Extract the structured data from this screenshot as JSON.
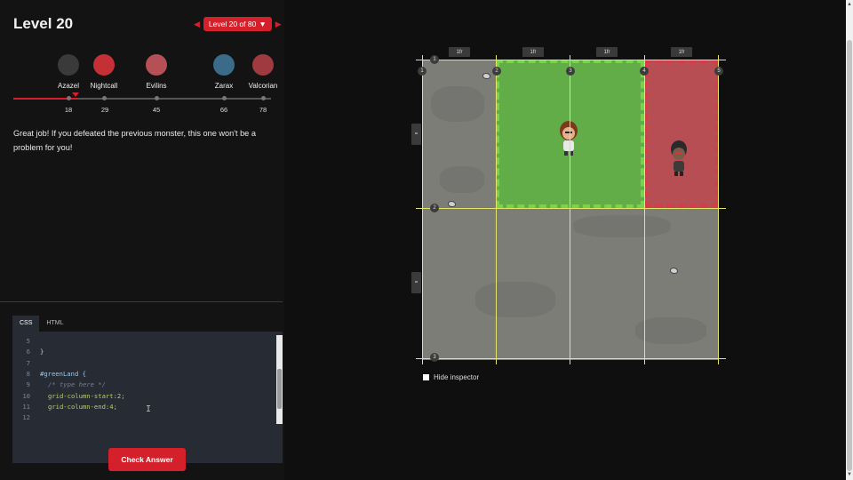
{
  "header": {
    "title": "Level 20",
    "level_selector": "Level 20 of 80"
  },
  "monsters": [
    {
      "name": "Azazel",
      "level": "18",
      "color": "#3a3a3a"
    },
    {
      "name": "Nightcall",
      "level": "29",
      "color": "#c43036"
    },
    {
      "name": "Evilins",
      "level": "45",
      "color": "#b45056"
    },
    {
      "name": "Zarax",
      "level": "66",
      "color": "#3a6c8a"
    },
    {
      "name": "Valcorian",
      "level": "78",
      "color": "#9e3a40"
    }
  ],
  "instructions": "Great job! If you defeated the previous monster, this one won't be a problem for you!",
  "editor": {
    "tabs": [
      "CSS",
      "HTML"
    ],
    "lines": [
      {
        "num": "5",
        "text": ""
      },
      {
        "num": "6",
        "text": "}"
      },
      {
        "num": "7",
        "text": ""
      },
      {
        "num": "8",
        "text": "#greenLand {"
      },
      {
        "num": "9",
        "text": "/* type here */"
      },
      {
        "num": "10",
        "text": "grid-column-start:2;"
      },
      {
        "num": "11",
        "text": "grid-column-end:4;"
      },
      {
        "num": "12",
        "text": ""
      }
    ],
    "check_button": "Check Answer"
  },
  "grid": {
    "column_labels": [
      "1fr",
      "1fr",
      "1fr",
      "1fr"
    ],
    "column_line_numbers": [
      "1",
      "2",
      "3",
      "4",
      "5"
    ],
    "row_line_numbers": [
      "1",
      "2",
      "3"
    ],
    "row_handles": [
      "=",
      "="
    ],
    "green_color": "#5abe37",
    "red_color": "#cd3c46"
  },
  "inspector_label": "Hide inspector",
  "icons": {
    "level_menu": "caret-down-icon",
    "prev": "triangle-left-icon",
    "next": "triangle-right-icon"
  }
}
